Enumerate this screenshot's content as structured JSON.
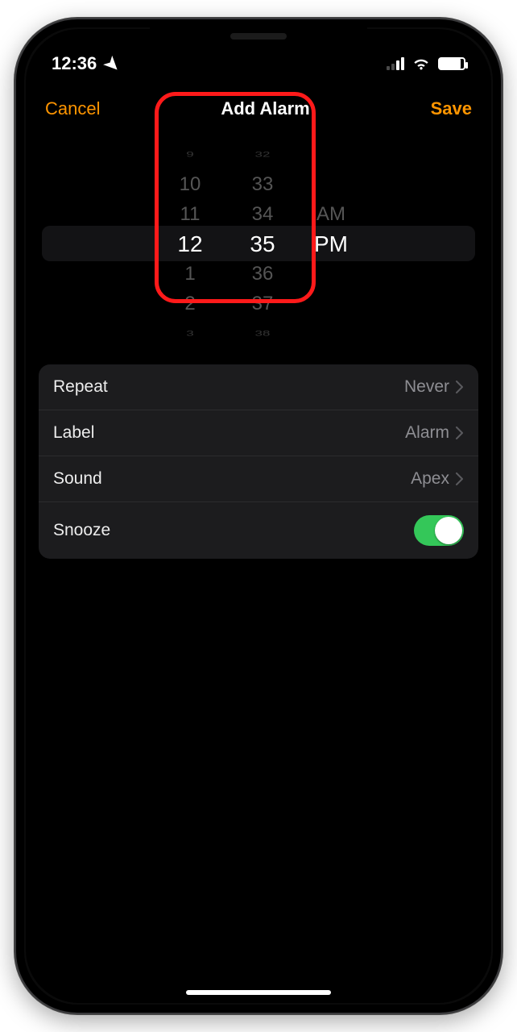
{
  "statusbar": {
    "time": "12:36",
    "location_icon": "location-arrow",
    "wifi_icon": "wifi-icon",
    "battery_icon": "battery-icon",
    "signal_icon": "cellular-signal-icon"
  },
  "navbar": {
    "cancel": "Cancel",
    "title": "Add Alarm",
    "save": "Save"
  },
  "picker": {
    "hours": [
      "9",
      "10",
      "11",
      "12",
      "1",
      "2",
      "3"
    ],
    "minutes": [
      "32",
      "33",
      "34",
      "35",
      "36",
      "37",
      "38"
    ],
    "ampm_above": "AM",
    "ampm_selected": "PM",
    "selected_hour": "12",
    "selected_minute": "35"
  },
  "settings": {
    "repeat": {
      "label": "Repeat",
      "value": "Never"
    },
    "label": {
      "label": "Label",
      "value": "Alarm"
    },
    "sound": {
      "label": "Sound",
      "value": "Apex"
    },
    "snooze": {
      "label": "Snooze",
      "on": true
    }
  },
  "annotation": {
    "highlight": "time-picker-highlight"
  },
  "colors": {
    "accent": "#ff9500",
    "switch_on": "#34c759",
    "highlight_red": "#ff1a1a"
  }
}
